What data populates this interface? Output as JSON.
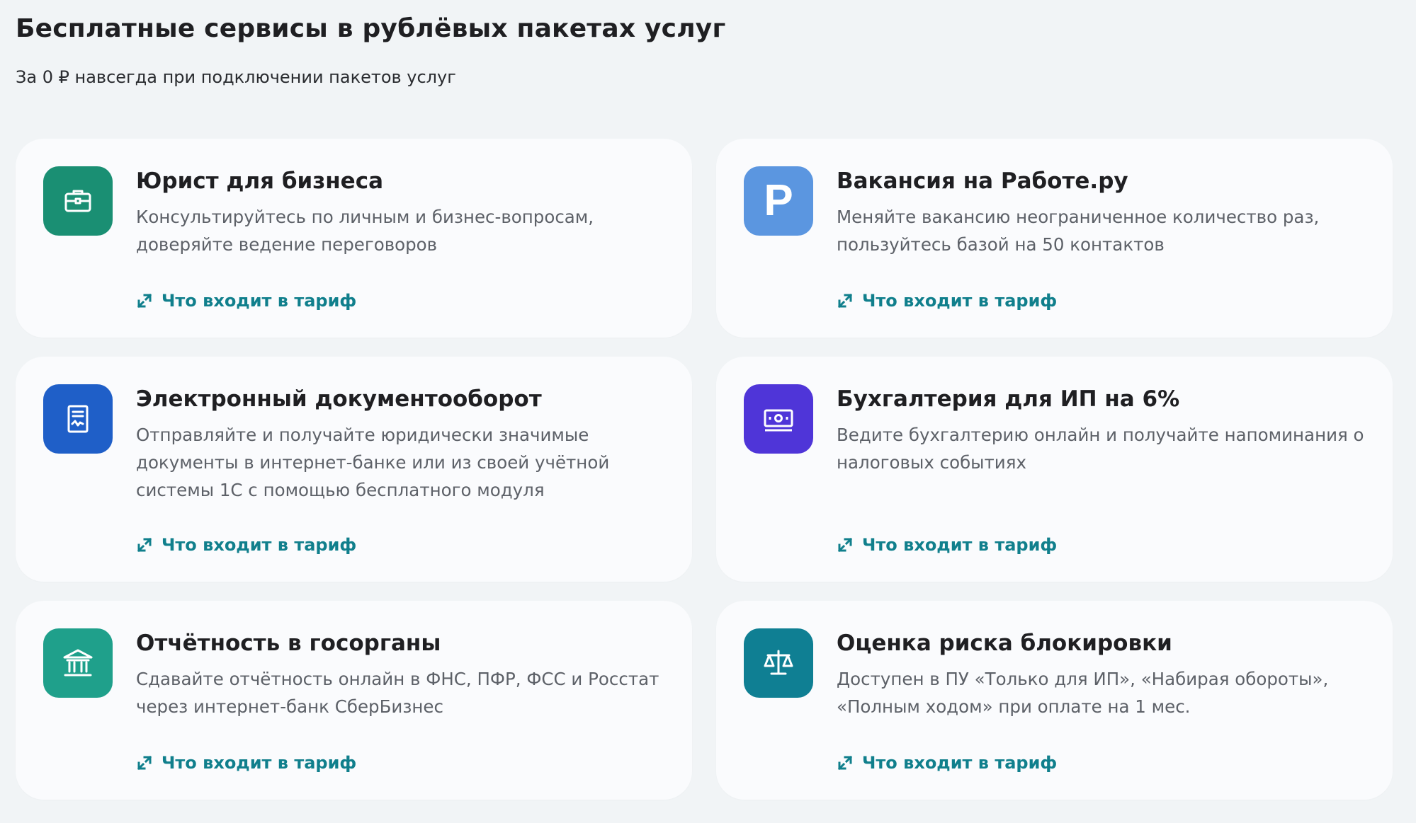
{
  "header": {
    "title": "Бесплатные сервисы в рублёвых пакетах услуг",
    "subtitle": "За 0 ₽ навсегда при подключении пакетов услуг"
  },
  "cards": [
    {
      "title": "Юрист для бизнеса",
      "description": "Консультируйтесь по личным и бизнес-вопросам, доверяйте ведение переговоров",
      "link": "Что входит в тариф",
      "icon": "briefcase-icon",
      "icon_color": "#1a8f73"
    },
    {
      "title": "Вакансия на Работе.ру",
      "description": "Меняйте вакансию неограниченное количество раз, пользуйтесь базой на 50 контактов",
      "link": "Что входит в тариф",
      "icon": "rabota-logo-icon",
      "icon_color": "#5b96e0",
      "icon_letter": "P"
    },
    {
      "title": "Электронный документооборот",
      "description": "Отправляйте и получайте юридически значимые документы в интернет-банке или из своей учётной системы 1С с помощью бесплатного модуля",
      "link": "Что входит в тариф",
      "icon": "signed-document-icon",
      "icon_color": "#1f5fc8"
    },
    {
      "title": "Бухгалтерия для ИП на 6%",
      "description": "Ведите бухгалтерию онлайн и получайте напоминания о налоговых событиях",
      "link": "Что входит в тариф",
      "icon": "banknote-icon",
      "icon_color": "#4f35d8"
    },
    {
      "title": "Отчётность в госорганы",
      "description": "Сдавайте отчётность онлайн в ФНС, ПФР, ФСС и Росстат через интернет-банк СберБизнес",
      "link": "Что входит в тариф",
      "icon": "government-building-icon",
      "icon_color": "#1fa08b"
    },
    {
      "title": "Оценка риска блокировки",
      "description": "Доступен в ПУ «Только для ИП», «Набирая обороты», «Полным ходом» при оплате на 1 мес.",
      "link": "Что входит в тариф",
      "icon": "scales-icon",
      "icon_color": "#0f7f93"
    }
  ],
  "colors": {
    "page_background": "#f1f4f6",
    "card_background": "#fafbfd",
    "link": "#107f8c",
    "title": "#1f1f22",
    "description": "#5d6168"
  }
}
